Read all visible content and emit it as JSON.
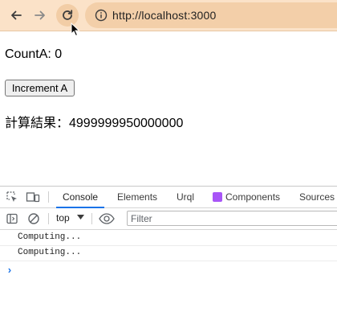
{
  "browser": {
    "url": "http://localhost:3000",
    "toolbar_color": "#fbe2c8",
    "address_bar_color": "#f3cfa9",
    "icons": [
      "back-arrow-icon",
      "forward-arrow-icon",
      "reload-icon",
      "site-info-icon"
    ]
  },
  "page": {
    "count_text": "CountA: 0",
    "increment_button": "Increment A",
    "result_text": "計算結果：4999999950000000"
  },
  "devtools": {
    "tabs": [
      {
        "label": "Console",
        "active": true
      },
      {
        "label": "Elements"
      },
      {
        "label": "Urql"
      },
      {
        "label": "Components"
      },
      {
        "label": "Sources"
      }
    ],
    "context": "top",
    "filter_placeholder": "Filter",
    "logs": [
      "Computing...",
      "Computing..."
    ],
    "prompt_symbol": "›",
    "accent_color": "#1a73e8"
  }
}
